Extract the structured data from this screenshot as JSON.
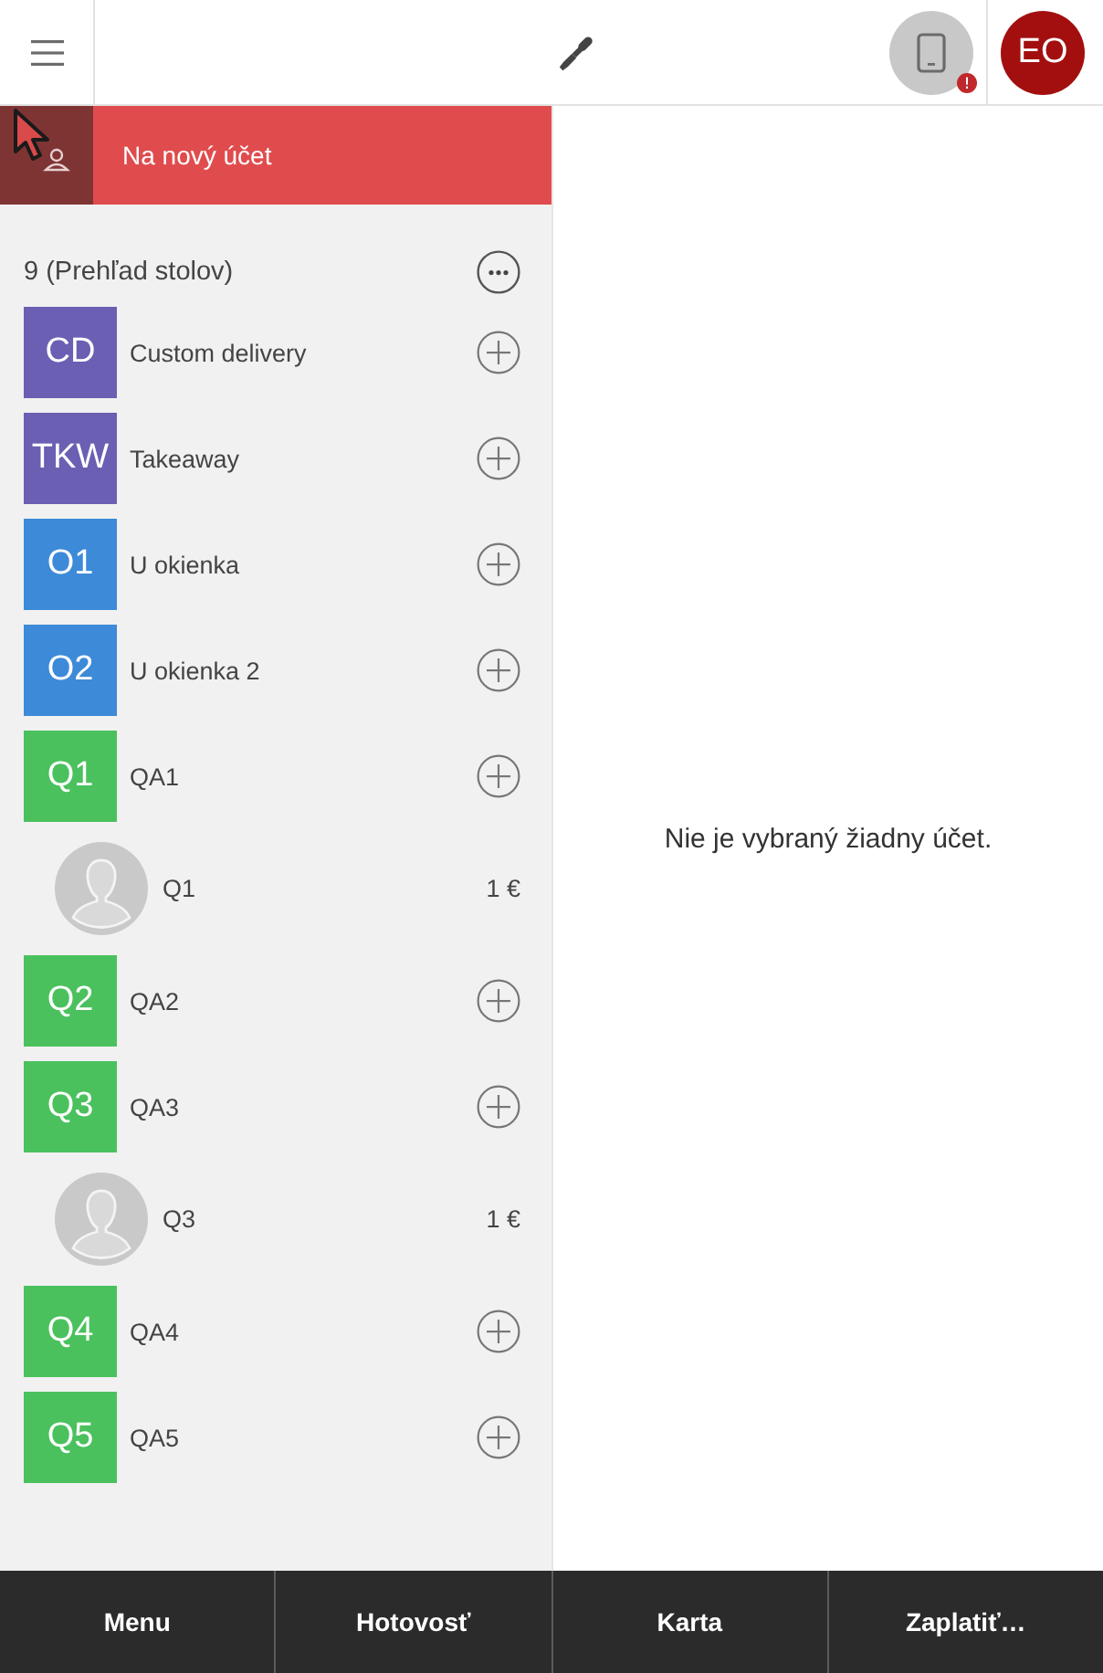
{
  "header": {
    "avatar_initials": "EO"
  },
  "new_account_bar": {
    "label": "Na nový účet"
  },
  "table_overview": {
    "title": "9 (Prehľad stolov)",
    "tables": [
      {
        "code": "CD",
        "name": "Custom delivery",
        "color": "#6a5fb3"
      },
      {
        "code": "TKW",
        "name": "Takeaway",
        "color": "#6a5fb3"
      },
      {
        "code": "O1",
        "name": "U okienka",
        "color": "#3d8ad8"
      },
      {
        "code": "O2",
        "name": "U okienka 2",
        "color": "#3d8ad8"
      },
      {
        "code": "Q1",
        "name": "QA1",
        "color": "#4ac15d",
        "children": [
          {
            "name": "Q1",
            "amount": "1 €"
          }
        ]
      },
      {
        "code": "Q2",
        "name": "QA2",
        "color": "#4ac15d"
      },
      {
        "code": "Q3",
        "name": "QA3",
        "color": "#4ac15d",
        "children": [
          {
            "name": "Q3",
            "amount": "1 €"
          }
        ]
      },
      {
        "code": "Q4",
        "name": "QA4",
        "color": "#4ac15d"
      },
      {
        "code": "Q5",
        "name": "QA5",
        "color": "#4ac15d"
      }
    ]
  },
  "empty_state": "Nie je vybraný žiadny účet.",
  "bottom_bar": [
    "Menu",
    "Hotovosť",
    "Karta",
    "Zaplatiť…"
  ]
}
